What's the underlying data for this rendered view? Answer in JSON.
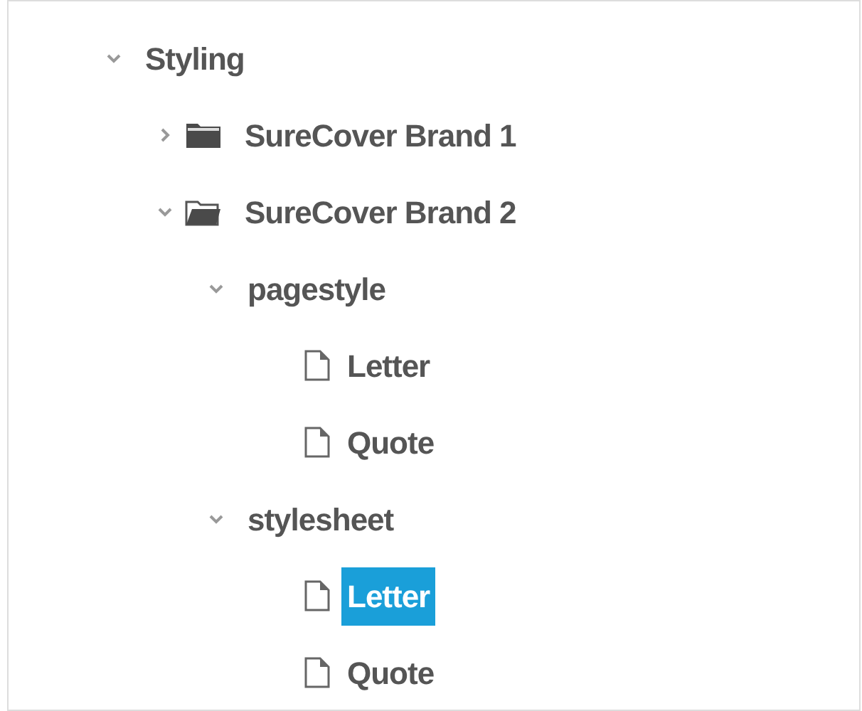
{
  "tree": [
    {
      "label": "Styling",
      "kind": "group",
      "expanded": true,
      "children": [
        {
          "label": "SureCover Brand 1",
          "kind": "folder",
          "expanded": false
        },
        {
          "label": "SureCover Brand 2",
          "kind": "folder",
          "expanded": true,
          "children": [
            {
              "label": "pagestyle",
              "kind": "group",
              "expanded": true,
              "children": [
                {
                  "label": "Letter",
                  "kind": "file",
                  "selected": false
                },
                {
                  "label": "Quote",
                  "kind": "file",
                  "selected": false
                }
              ]
            },
            {
              "label": "stylesheet",
              "kind": "group",
              "expanded": true,
              "children": [
                {
                  "label": "Letter",
                  "kind": "file",
                  "selected": true
                },
                {
                  "label": "Quote",
                  "kind": "file",
                  "selected": false
                }
              ]
            }
          ]
        }
      ]
    }
  ]
}
